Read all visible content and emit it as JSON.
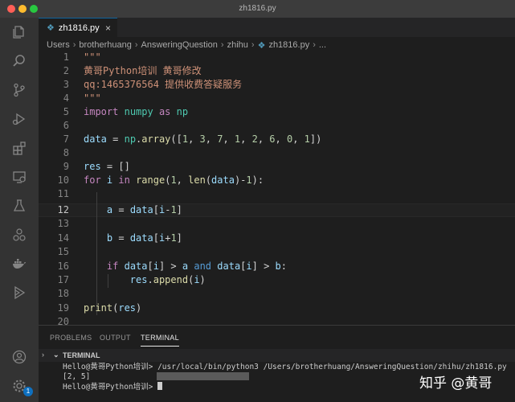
{
  "window": {
    "title": "zh1816.py"
  },
  "tab": {
    "label": "zh1816.py",
    "close": "×"
  },
  "breadcrumb": {
    "items": [
      "Users",
      "brotherhuang",
      "AnsweringQuestion",
      "zhihu",
      "zh1816.py",
      "..."
    ]
  },
  "editor": {
    "line_numbers": [
      "1",
      "2",
      "3",
      "4",
      "5",
      "6",
      "7",
      "8",
      "9",
      "10",
      "11",
      "12",
      "13",
      "14",
      "15",
      "16",
      "17",
      "18",
      "19",
      "20"
    ],
    "current_line": "12",
    "code": {
      "l1": "\"\"\"",
      "l2": "黄哥Python培训 黄哥修改",
      "l3": "qq:1465376564 提供收费答疑服务",
      "l4": "\"\"\"",
      "l5a": "import",
      "l5b": "numpy",
      "l5c": "as",
      "l5d": "np",
      "l7a": "data",
      "l7b": " = ",
      "l7c": "np",
      "l7d": ".",
      "l7e": "array",
      "l7f": "([",
      "l7n": [
        "1",
        "3",
        "7",
        "1",
        "2",
        "6",
        "0",
        "1"
      ],
      "l7g": "])",
      "l9a": "res",
      "l9b": " = []",
      "l10a": "for",
      "l10b": "i",
      "l10c": "in",
      "l10d": "range",
      "l10e": "(",
      "l10f": "1",
      "l10g": ", ",
      "l10h": "len",
      "l10i": "(",
      "l10j": "data",
      "l10k": ")-",
      "l10l": "1",
      "l10m": "):",
      "l12a": "a",
      "l12b": " = ",
      "l12c": "data",
      "l12d": "[",
      "l12e": "i",
      "l12f": "-",
      "l12g": "1",
      "l12h": "]",
      "l14a": "b",
      "l14b": " = ",
      "l14c": "data",
      "l14d": "[",
      "l14e": "i",
      "l14f": "+",
      "l14g": "1",
      "l14h": "]",
      "l16a": "if",
      "l16b": "data",
      "l16c": "[",
      "l16d": "i",
      "l16e": "] > ",
      "l16f": "a",
      "l16g": "and",
      "l16h": "data",
      "l16i": "[",
      "l16j": "i",
      "l16k": "] > ",
      "l16l": "b",
      "l16m": ":",
      "l17a": "res",
      "l17b": ".",
      "l17c": "append",
      "l17d": "(",
      "l17e": "i",
      "l17f": ")",
      "l19a": "print",
      "l19b": "(",
      "l19c": "res",
      "l19d": ")"
    }
  },
  "panel": {
    "tabs": [
      "PROBLEMS",
      "OUTPUT",
      "TERMINAL"
    ],
    "active": "TERMINAL"
  },
  "terminal": {
    "header": "TERMINAL",
    "line1": "Hello@黄哥Python培训> /usr/local/bin/python3 /Users/brotherhuang/AnsweringQuestion/zhihu/zh1816.py",
    "line2": "[2, 5]",
    "line3": "Hello@黄哥Python培训> "
  },
  "watermark": "知乎 @黄哥",
  "accounts_badge": "1",
  "icons": [
    "explorer-icon",
    "search-icon",
    "source-control-icon",
    "run-debug-icon",
    "extensions-icon",
    "remote-explorer-icon",
    "testing-icon",
    "source-graph-icon",
    "docker-icon",
    "live-share-icon",
    "account-icon",
    "settings-gear-icon"
  ]
}
